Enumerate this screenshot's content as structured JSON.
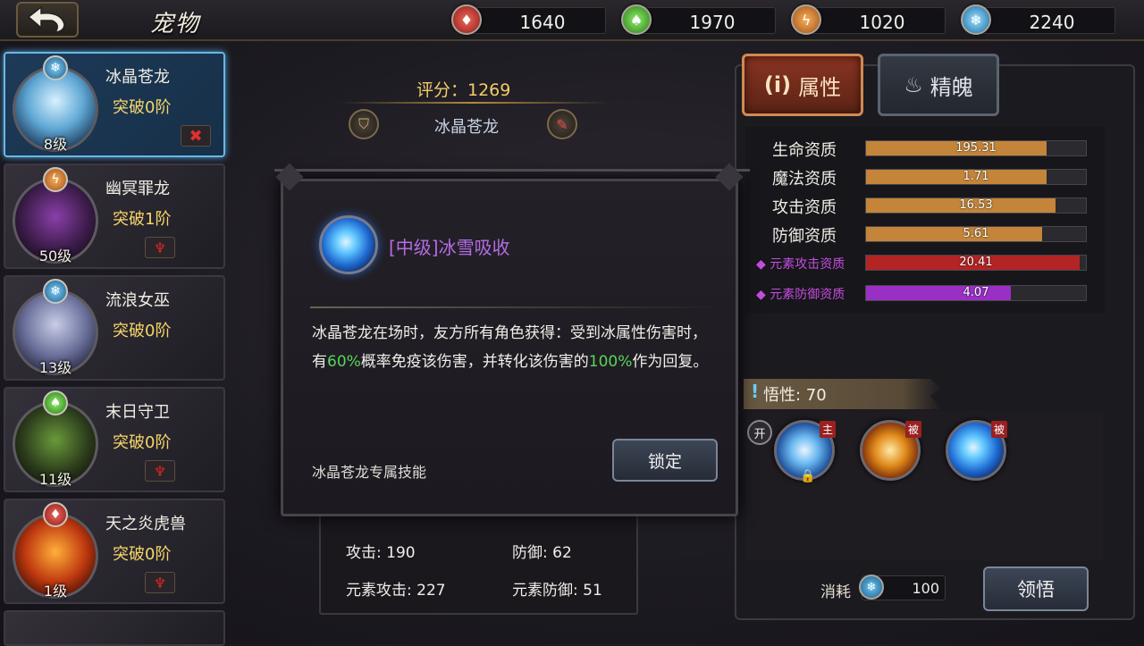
{
  "header": {
    "title": "宠物",
    "resources": [
      {
        "icon": "fire-gem-icon",
        "color": "#d4383a",
        "value": "1640"
      },
      {
        "icon": "leaf-gem-icon",
        "color": "#4ebd3a",
        "value": "1970"
      },
      {
        "icon": "lightning-gem-icon",
        "color": "#e08a2a",
        "value": "1020"
      },
      {
        "icon": "ice-gem-icon",
        "color": "#3ea4dc",
        "value": "2240"
      }
    ]
  },
  "pets": [
    {
      "name": "冰晶苍龙",
      "breakthrough": "突破0阶",
      "level": "8级",
      "element": "ice",
      "selected": true
    },
    {
      "name": "幽冥罪龙",
      "breakthrough": "突破1阶",
      "level": "50级",
      "element": "lightning",
      "selected": false
    },
    {
      "name": "流浪女巫",
      "breakthrough": "突破0阶",
      "level": "13级",
      "element": "ice",
      "selected": false
    },
    {
      "name": "末日守卫",
      "breakthrough": "突破0阶",
      "level": "11级",
      "element": "poison",
      "selected": false
    },
    {
      "name": "天之炎虎兽",
      "breakthrough": "突破0阶",
      "level": "1级",
      "element": "fire",
      "selected": false
    }
  ],
  "detail": {
    "score": "评分：1269",
    "name": "冰晶苍龙",
    "stats": {
      "attack": "攻击: 190",
      "defense": "防御: 62",
      "elem_attack": "元素攻击: 227",
      "elem_defense": "元素防御: 51"
    }
  },
  "tabs": {
    "attributes": "属性",
    "spirit": "精魄"
  },
  "aptitudes": [
    {
      "label": "生命资质",
      "value": "195.31",
      "fill": 0.82,
      "color": "#c4853a",
      "elemental": false
    },
    {
      "label": "魔法资质",
      "value": "1.71",
      "fill": 0.82,
      "color": "#c4853a",
      "elemental": false
    },
    {
      "label": "攻击资质",
      "value": "16.53",
      "fill": 0.86,
      "color": "#c4853a",
      "elemental": false
    },
    {
      "label": "防御资质",
      "value": "5.61",
      "fill": 0.8,
      "color": "#c4853a",
      "elemental": false
    },
    {
      "label": "◆ 元素攻击资质",
      "value": "20.41",
      "fill": 0.97,
      "color": "#b32424",
      "elemental": true
    },
    {
      "label": "◆ 元素防御资质",
      "value": "4.07",
      "fill": 0.66,
      "color": "#9a2fc6",
      "elemental": true
    }
  ],
  "wisdom": "悟性: 70",
  "skills": {
    "open_badge": "开",
    "slots": [
      {
        "tag": "主",
        "icon": "ice-crystal-skill-icon"
      },
      {
        "tag": "被",
        "icon": "golden-slash-skill-icon"
      },
      {
        "tag": "被",
        "icon": "ice-vortex-skill-icon"
      }
    ]
  },
  "cost": {
    "label": "消耗",
    "value": "100"
  },
  "learn_button": "领悟",
  "modal": {
    "title": "[中级]冰雪吸收",
    "desc_1": "冰晶苍龙在场时，友方所有角色获得：受到冰属性伤害时，有",
    "desc_pct1": "60%",
    "desc_2": "概率免疫该伤害，并转化该伤害的",
    "desc_pct2": "100%",
    "desc_3": "作为回复。",
    "footer": "冰晶苍龙专属技能",
    "lock_button": "锁定"
  }
}
